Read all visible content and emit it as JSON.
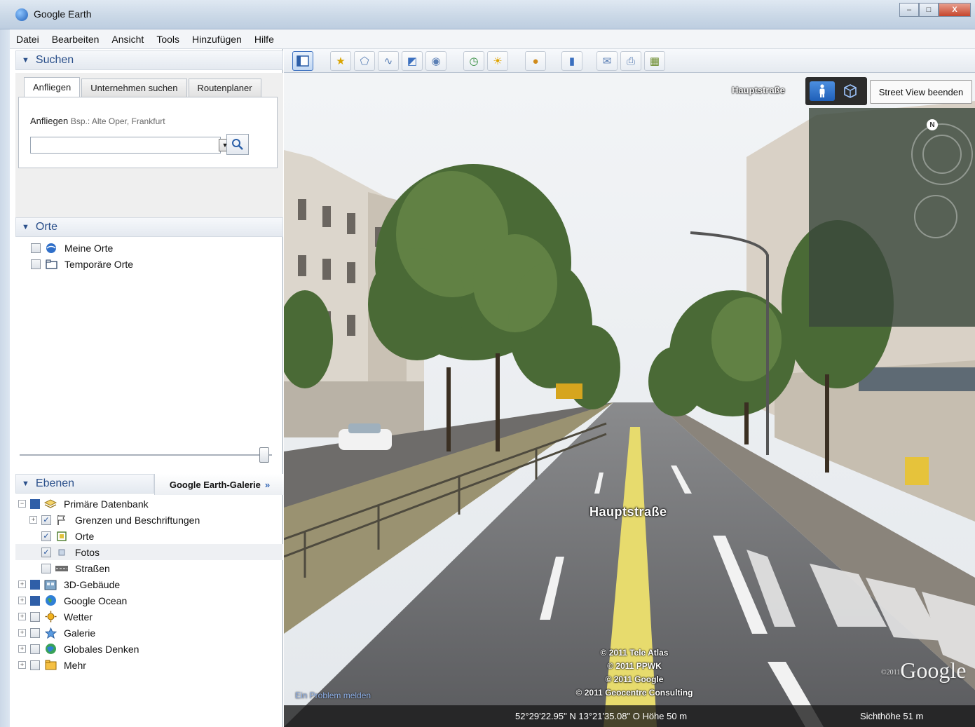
{
  "window": {
    "title": "Google Earth",
    "minimize": "–",
    "maximize": "□",
    "close": "X"
  },
  "menu": [
    "Datei",
    "Bearbeiten",
    "Ansicht",
    "Tools",
    "Hinzufügen",
    "Hilfe"
  ],
  "search": {
    "header": "Suchen",
    "tabs": [
      "Anfliegen",
      "Unternehmen suchen",
      "Routenplaner"
    ],
    "active_tab": "Anfliegen",
    "fly_label": "Anfliegen",
    "fly_hint": "Bsp.: Alte Oper, Frankfurt",
    "fly_value": ""
  },
  "places": {
    "header": "Orte",
    "items": [
      "Meine Orte",
      "Temporäre Orte"
    ]
  },
  "layers": {
    "header": "Ebenen",
    "gallery_button": "Google Earth-Galerie",
    "gallery_chevron": "»",
    "root": "Primäre Datenbank",
    "items": [
      {
        "label": "Grenzen und Beschriftungen",
        "checked": true
      },
      {
        "label": "Orte",
        "checked": true
      },
      {
        "label": "Fotos",
        "checked": true
      },
      {
        "label": "Straßen",
        "checked": false
      },
      {
        "label": "3D-Gebäude",
        "checked": false
      },
      {
        "label": "Google Ocean",
        "checked": false
      },
      {
        "label": "Wetter",
        "checked": false
      },
      {
        "label": "Galerie",
        "checked": false
      },
      {
        "label": "Globales Denken",
        "checked": false
      },
      {
        "label": "Mehr",
        "checked": false
      }
    ]
  },
  "streetview": {
    "street_top": "Hauptstraße",
    "street_label": "Hauptstraße",
    "exit_button": "Street View beenden",
    "nav_north": "N",
    "copyright": [
      "© 2011 Tele Atlas",
      "© 2011 PPWK",
      "© 2011 Google",
      "© 2011 Geocentre Consulting"
    ],
    "report_link": "Ein Problem melden",
    "logo": "Google",
    "logo_prefix": "©2011",
    "coords": "52°29'22.95\" N   13°21'35.08\" O   Höhe   50 m",
    "altitude": "Sichthöhe    51 m"
  },
  "colors": {
    "accent": "#2a4f8a",
    "link": "#8fb1e8",
    "road": "#5e5f62",
    "lane": "#e7db6d"
  }
}
